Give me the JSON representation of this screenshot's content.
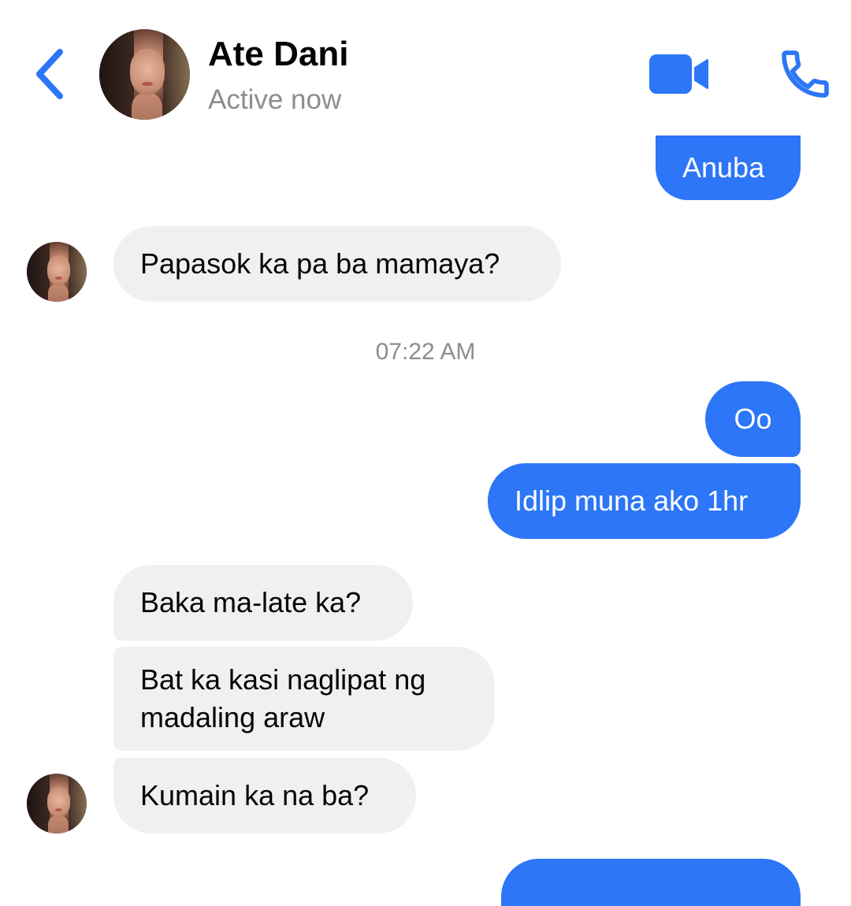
{
  "header": {
    "contact_name": "Ate Dani",
    "status": "Active now",
    "icons": {
      "back": "chevron-left-icon",
      "video": "video-camera-icon",
      "call": "phone-icon"
    },
    "accent_color": "#2c76f7"
  },
  "messages": [
    {
      "direction": "outgoing",
      "text": "Anuba"
    },
    {
      "direction": "incoming",
      "text": "Papasok ka pa ba mamaya?"
    },
    {
      "type": "timestamp",
      "text": "07:22 AM"
    },
    {
      "direction": "outgoing",
      "text": "Oo"
    },
    {
      "direction": "outgoing",
      "text": "Idlip muna ako 1hr"
    },
    {
      "direction": "incoming",
      "text": "Baka ma-late ka?"
    },
    {
      "direction": "incoming",
      "text": "Bat ka kasi naglipat ng madaling araw"
    },
    {
      "direction": "incoming",
      "text": "Kumain ka na ba?"
    },
    {
      "direction": "outgoing",
      "text": ""
    }
  ],
  "colors": {
    "outgoing_bubble": "#2c76f7",
    "incoming_bubble": "#f0f0f0",
    "secondary_text": "#8a8d91"
  }
}
